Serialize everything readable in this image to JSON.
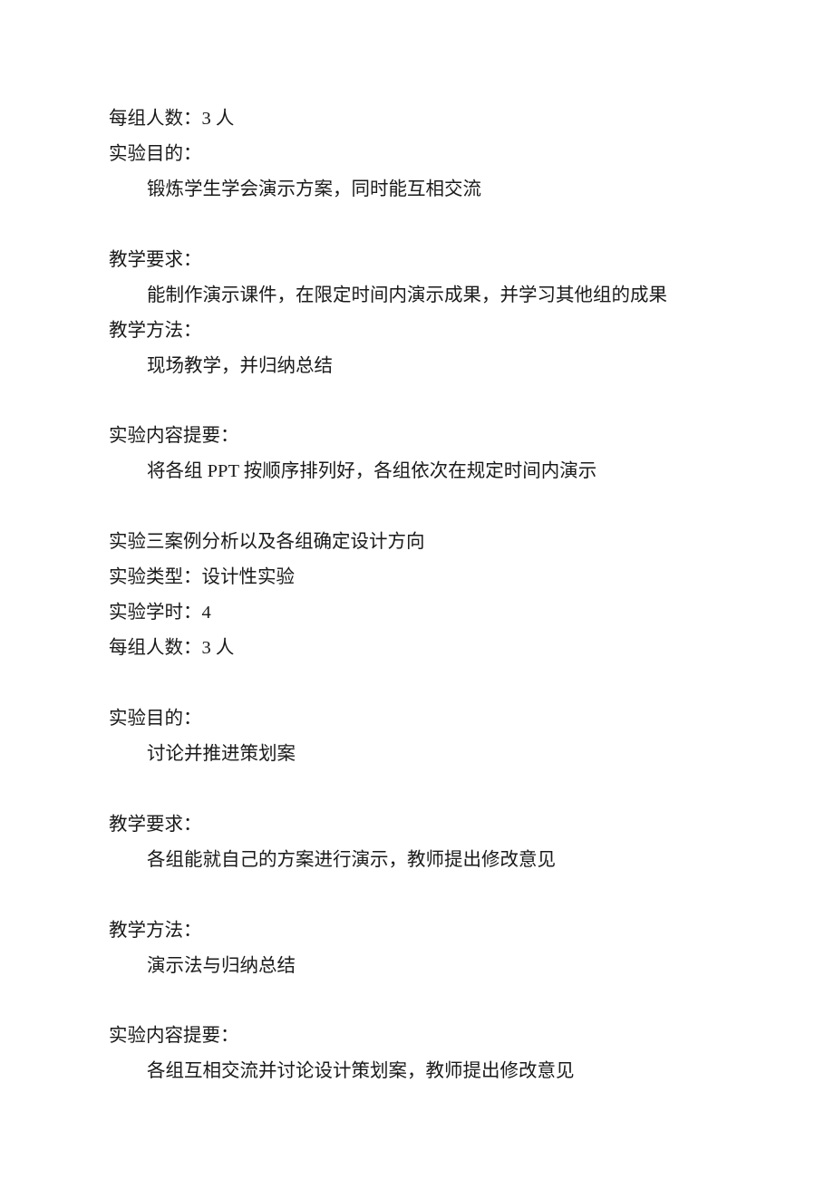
{
  "block1": {
    "ln1": "每组人数：3 人",
    "ln2": "实验目的：",
    "ln3": "锻炼学生学会演示方案，同时能互相交流",
    "ln4": "教学要求：",
    "ln5": "能制作演示课件，在限定时间内演示成果，并学习其他组的成果",
    "ln6": "教学方法：",
    "ln7": "现场教学，并归纳总结",
    "ln8": "实验内容提要：",
    "ln9": "将各组 PPT 按顺序排列好，各组依次在规定时间内演示"
  },
  "block2": {
    "ln1": "实验三案例分析以及各组确定设计方向",
    "ln2": "实验类型：设计性实验",
    "ln3": "实验学时：4",
    "ln4": "每组人数：3 人",
    "ln5": "实验目的：",
    "ln6": "讨论并推进策划案",
    "ln7": "教学要求：",
    "ln8": "各组能就自己的方案进行演示，教师提出修改意见",
    "ln9": "教学方法：",
    "ln10": "演示法与归纳总结",
    "ln11": "实验内容提要：",
    "ln12": "各组互相交流并讨论设计策划案，教师提出修改意见"
  }
}
